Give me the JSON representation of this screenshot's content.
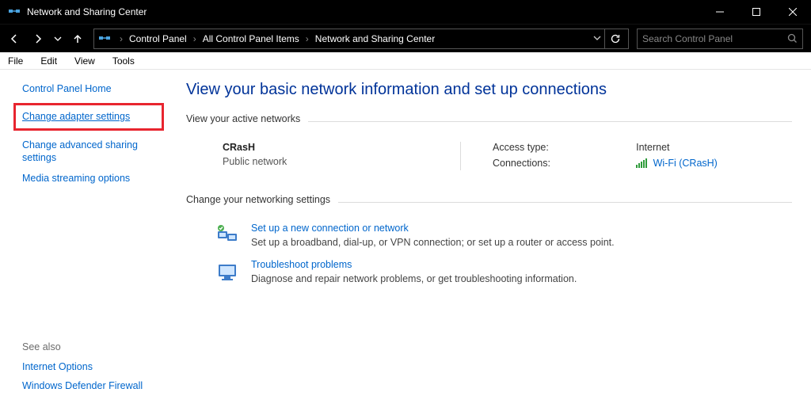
{
  "window": {
    "title": "Network and Sharing Center"
  },
  "breadcrumb": {
    "items": [
      "Control Panel",
      "All Control Panel Items",
      "Network and Sharing Center"
    ]
  },
  "search": {
    "placeholder": "Search Control Panel"
  },
  "menu": {
    "file": "File",
    "edit": "Edit",
    "view": "View",
    "tools": "Tools"
  },
  "sidebar": {
    "home": "Control Panel Home",
    "adapter": "Change adapter settings",
    "advanced": "Change advanced sharing settings",
    "media": "Media streaming options",
    "seealso_label": "See also",
    "internet_options": "Internet Options",
    "firewall": "Windows Defender Firewall"
  },
  "main": {
    "heading": "View your basic network information and set up connections",
    "active_label": "View your active networks",
    "network": {
      "name": "CRasH",
      "type": "Public network",
      "access_label": "Access type:",
      "access_value": "Internet",
      "conn_label": "Connections:",
      "conn_value": "Wi-Fi (CRasH)"
    },
    "change_label": "Change your networking settings",
    "task1": {
      "title": "Set up a new connection or network",
      "desc": "Set up a broadband, dial-up, or VPN connection; or set up a router or access point."
    },
    "task2": {
      "title": "Troubleshoot problems",
      "desc": "Diagnose and repair network problems, or get troubleshooting information."
    }
  }
}
